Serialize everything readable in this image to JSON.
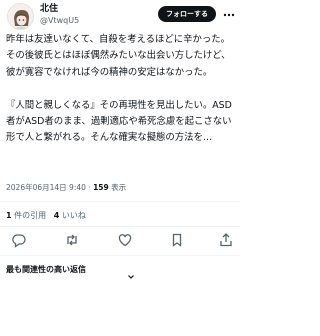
{
  "author": {
    "name": "北住",
    "handle": "@VtwqU5"
  },
  "follow_label": "フォローする",
  "tweet": {
    "text": "昨年は友達いなくて、自殺を考えるほどに辛かった。その後彼氏とはほぼ偶然みたいな出会い方したけど、彼が寛容でなければ今の精神の安定はなかった。\n\n『人間と親しくなる』その再現性を見出したい。ASD者がASD者のまま、過剰適応や希死念慮を起こさない形で人と繋がれる。そんな確実な擬態の方法を…",
    "timestamp": "2026年06月14日 9:40",
    "separator": " · ",
    "views_count": "159",
    "views_label": " 表示"
  },
  "stats": {
    "quotes_count": "1",
    "quotes_label": "件の引用",
    "likes_count": "4",
    "likes_label": "いいね"
  },
  "actions": [
    "reply-icon",
    "retweet-icon",
    "like-icon",
    "bookmark-icon",
    "share-icon"
  ],
  "replies_sort": {
    "label": "最も関連性の高い返信"
  },
  "colors": {
    "text": "#0f1419",
    "muted": "#536471",
    "divider": "#eff3f4",
    "button": "#0f1419"
  }
}
